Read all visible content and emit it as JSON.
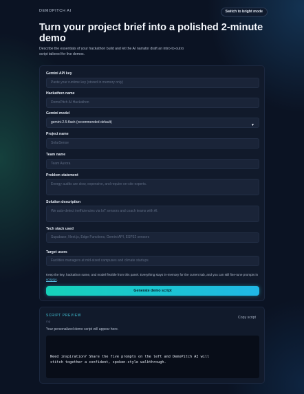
{
  "header": {
    "brand": "DEMOPITCH AI",
    "mode_toggle": "Switch to bright mode"
  },
  "hero": {
    "title": "Turn your project brief into a polished 2-minute demo",
    "description": "Describe the essentials of your hackathon build and let the AI narrator draft an intro-to-outro script tailored for live demos."
  },
  "form": {
    "api_key": {
      "label": "Gemini API key",
      "placeholder": "Paste your runtime key (stored in memory only)"
    },
    "hackathon": {
      "label": "Hackathon name",
      "placeholder": "DemoPitch AI Hackathon"
    },
    "model": {
      "label": "Gemini model",
      "value": "gemini-2.5-flash (recommended default)"
    },
    "project": {
      "label": "Project name",
      "placeholder": "SolarSense"
    },
    "team": {
      "label": "Team name",
      "placeholder": "Team Aurora"
    },
    "problem": {
      "label": "Problem statement",
      "placeholder": "Energy audits are slow, expensive, and require on-site experts."
    },
    "solution": {
      "label": "Solution description",
      "placeholder": "We auto-detect inefficiencies via IoT sensors and coach teams with AI."
    },
    "tech": {
      "label": "Tech stack used",
      "placeholder": "Supabase, Next.js, Edge Functions, Gemini API, ESP32 sensors"
    },
    "users": {
      "label": "Target users",
      "placeholder": "Facilities managers at mid-sized campuses and climate startups"
    },
    "note_text": "Keep the key, hackathon name, and model flexible from this panel. Everything stays in-memory for the current tab, and you can still fine-tune prompts in ",
    "note_link": "script.js",
    "note_end": ".",
    "submit": "Generate demo script"
  },
  "preview": {
    "tag": "SCRIPT PREVIEW",
    "sub": "mp",
    "copy": "Copy script",
    "status": "Your personalized demo script will appear here.",
    "output": "Need inspiration? Share the five prompts on the left and DemoPitch AI will\nstitch together a confident, spoken-style walkthrough."
  },
  "colors": {
    "background": "#0b1323",
    "accent_start": "#16d3b9",
    "accent_end": "#20b8e6",
    "card": "#111a2b"
  }
}
